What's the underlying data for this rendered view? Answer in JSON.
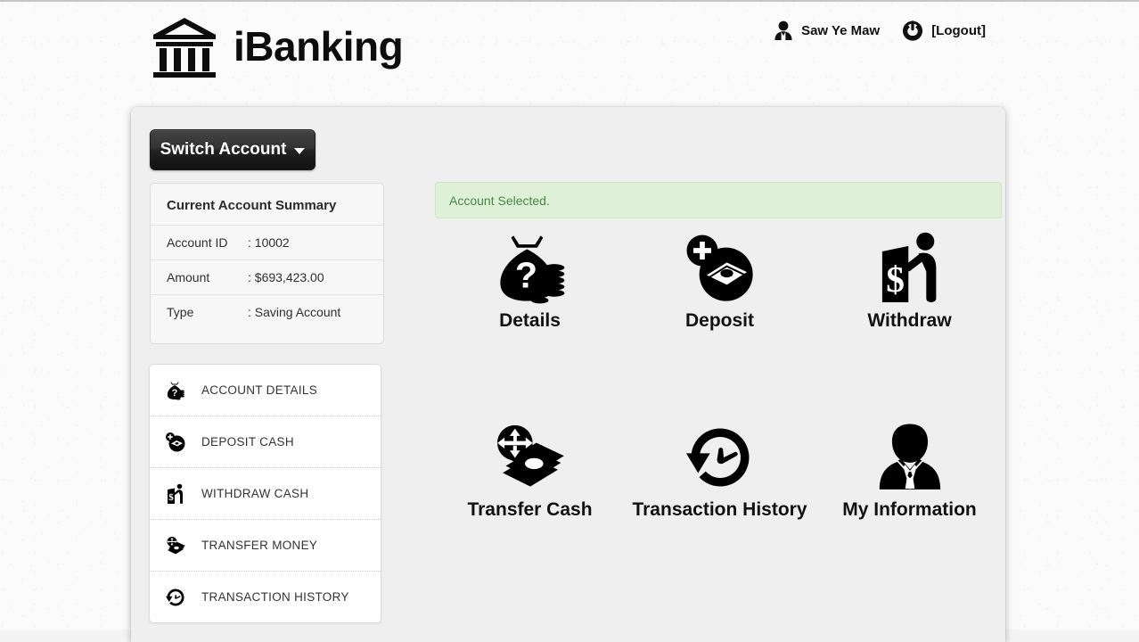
{
  "header": {
    "brand_title": "iBanking",
    "brand_logo_icon": "bank-building-icon",
    "user_icon": "user-avatar-icon",
    "user_name": "Saw Ye Maw",
    "power_icon": "power-icon",
    "logout_label": "[Logout]"
  },
  "toolbar": {
    "switch_account_label": "Switch Account",
    "caret_icon": "caret-down-icon"
  },
  "summary": {
    "title": "Current Account Summary",
    "rows": [
      {
        "label": "Account ID",
        "value": ": 10002"
      },
      {
        "label": "Amount",
        "value": ": $693,423.00"
      },
      {
        "label": "Type",
        "value": ": Saving Account"
      }
    ]
  },
  "sidebar": {
    "items": [
      {
        "label": "ACCOUNT DETAILS",
        "icon": "money-bag-question-icon"
      },
      {
        "label": "DEPOSIT CASH",
        "icon": "deposit-plus-icon"
      },
      {
        "label": "WITHDRAW CASH",
        "icon": "atm-person-icon"
      },
      {
        "label": "TRANSFER MONEY",
        "icon": "transfer-arrows-cash-icon"
      },
      {
        "label": "TRANSACTION HISTORY",
        "icon": "history-clock-icon"
      }
    ]
  },
  "alert": {
    "message": "Account Selected.",
    "bg_color": "#dff0d8",
    "border_color": "#cfe6bf",
    "text_color": "#468847"
  },
  "tiles": {
    "row1": [
      {
        "label": "Details",
        "icon": "money-bag-question-icon"
      },
      {
        "label": "Deposit",
        "icon": "deposit-plus-icon"
      },
      {
        "label": "Withdraw",
        "icon": "atm-person-icon"
      }
    ],
    "row2": [
      {
        "label": "Transfer Cash",
        "icon": "transfer-arrows-cash-icon"
      },
      {
        "label": "Transaction History",
        "icon": "history-clock-icon"
      },
      {
        "label": "My Information",
        "icon": "person-suit-icon"
      }
    ]
  },
  "theme": {
    "panel_bg": "#efefef",
    "page_bg": "#fbfbfb",
    "button_dark": "#222222"
  }
}
